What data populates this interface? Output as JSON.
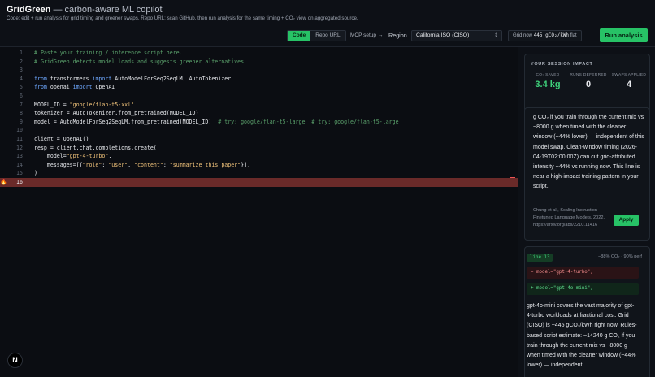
{
  "app": {
    "name": "GridGreen",
    "tagline": "— carbon-aware ML copilot",
    "subtitle": "Code: edit + run analysis for grid timing and greener swaps. Repo URL: scan GitHub, then run analysis for the same timing + CO₂ view on aggregated source."
  },
  "toolbar": {
    "mode_tabs": [
      "Code",
      "Repo URL"
    ],
    "active_mode": "Code",
    "mcp_setup": "MCP setup →",
    "region_label": "Region",
    "region_value": "California ISO (CISO)",
    "grid_now_label": "Grid now",
    "grid_now_value": "445 gCO₂/kWh",
    "grid_now_trend": "flat",
    "run_button": "Run analysis"
  },
  "editor": {
    "lines": [
      {
        "n": "1",
        "parts": [
          {
            "t": "# Paste your training / inference script here.",
            "c": "cm"
          }
        ]
      },
      {
        "n": "2",
        "parts": [
          {
            "t": "# GridGreen detects model loads and suggests greener alternatives.",
            "c": "cm"
          }
        ]
      },
      {
        "n": "3",
        "parts": []
      },
      {
        "n": "4",
        "parts": [
          {
            "t": "from",
            "c": "kw"
          },
          {
            "t": " transformers ",
            "c": "nm"
          },
          {
            "t": "import",
            "c": "kw"
          },
          {
            "t": " AutoModelForSeq2SeqLM, AutoTokenizer",
            "c": "nm"
          }
        ]
      },
      {
        "n": "5",
        "parts": [
          {
            "t": "from",
            "c": "kw"
          },
          {
            "t": " openai ",
            "c": "nm"
          },
          {
            "t": "import",
            "c": "kw"
          },
          {
            "t": " OpenAI",
            "c": "nm"
          }
        ]
      },
      {
        "n": "6",
        "parts": []
      },
      {
        "n": "7",
        "parts": [
          {
            "t": "MODEL_ID = ",
            "c": "nm"
          },
          {
            "t": "\"google/flan-t5-xxl\"",
            "c": "st"
          }
        ]
      },
      {
        "n": "8",
        "parts": [
          {
            "t": "tokenizer = AutoTokenizer.from_pretrained(MODEL_ID)",
            "c": "nm"
          }
        ]
      },
      {
        "n": "9",
        "parts": [
          {
            "t": "model = AutoModelForSeq2SeqLM.from_pretrained(MODEL_ID)  ",
            "c": "nm"
          },
          {
            "t": "# try: google/flan-t5-large  # try: google/flan-t5-large",
            "c": "cm"
          }
        ]
      },
      {
        "n": "10",
        "parts": []
      },
      {
        "n": "11",
        "parts": [
          {
            "t": "client = OpenAI()",
            "c": "nm"
          }
        ]
      },
      {
        "n": "12",
        "parts": [
          {
            "t": "resp = client.chat.completions.create(",
            "c": "nm"
          }
        ]
      },
      {
        "n": "13",
        "parts": [
          {
            "t": "    model=",
            "c": "nm"
          },
          {
            "t": "\"gpt-4-turbo\"",
            "c": "st"
          },
          {
            "t": ",",
            "c": "nm"
          }
        ]
      },
      {
        "n": "14",
        "parts": [
          {
            "t": "    messages=[{",
            "c": "nm"
          },
          {
            "t": "\"role\"",
            "c": "st"
          },
          {
            "t": ": ",
            "c": "nm"
          },
          {
            "t": "\"user\"",
            "c": "st"
          },
          {
            "t": ", ",
            "c": "nm"
          },
          {
            "t": "\"content\"",
            "c": "st"
          },
          {
            "t": ": ",
            "c": "nm"
          },
          {
            "t": "\"summarize this paper\"",
            "c": "st"
          },
          {
            "t": "}],",
            "c": "nm"
          }
        ]
      },
      {
        "n": "15",
        "parts": [
          {
            "t": ")",
            "c": "nm"
          }
        ]
      },
      {
        "n": "16",
        "parts": [],
        "highlight": true
      }
    ],
    "highlight_marker": "🔥"
  },
  "sidebar": {
    "impact_heading": "YOUR SESSION IMPACT",
    "stats": [
      {
        "label": "CO₂ SAVED",
        "value": "3.4 kg",
        "accent": true
      },
      {
        "label": "RUNS DEFERRED",
        "value": "0",
        "accent": false
      },
      {
        "label": "SWAPS APPLIED",
        "value": "4",
        "accent": false
      }
    ],
    "suggestion1": {
      "text": "g CO₂ if you train through the current mix vs ~8000 g when timed with the cleaner window (~44% lower) — independent of this model swap. Clean-window timing (2026-04-19T02:00:00Z) can cut grid-attributed intensity ~44% vs running now. This line is near a high-impact training pattern in your script.",
      "citation": "Chung et al., Scaling Instruction-Finetuned Language Models, 2022. https://arxiv.org/abs/2210.11416",
      "apply_label": "Apply"
    },
    "suggestion2": {
      "line_badge": "line 13",
      "savings": "−88% CO₂ · 90% perf",
      "diff_minus": "− model=\"gpt-4-turbo\",",
      "diff_plus": "+ model=\"gpt-4o-mini\",",
      "text": "gpt-4o-mini covers the vast majority of gpt-4-turbo workloads at fractional cost. Grid (CISO) is ~445 gCO₂/kWh right now. Rules-based script estimate: ~14240 g CO₂ if you train through the current mix vs ~8000 g when timed with the cleaner window (~44% lower) — independent"
    }
  },
  "footer": {
    "logo_letter": "N"
  },
  "colors": {
    "accent": "#27c266",
    "highlight_line": "#6a2a29",
    "background": "#0b0d12"
  }
}
